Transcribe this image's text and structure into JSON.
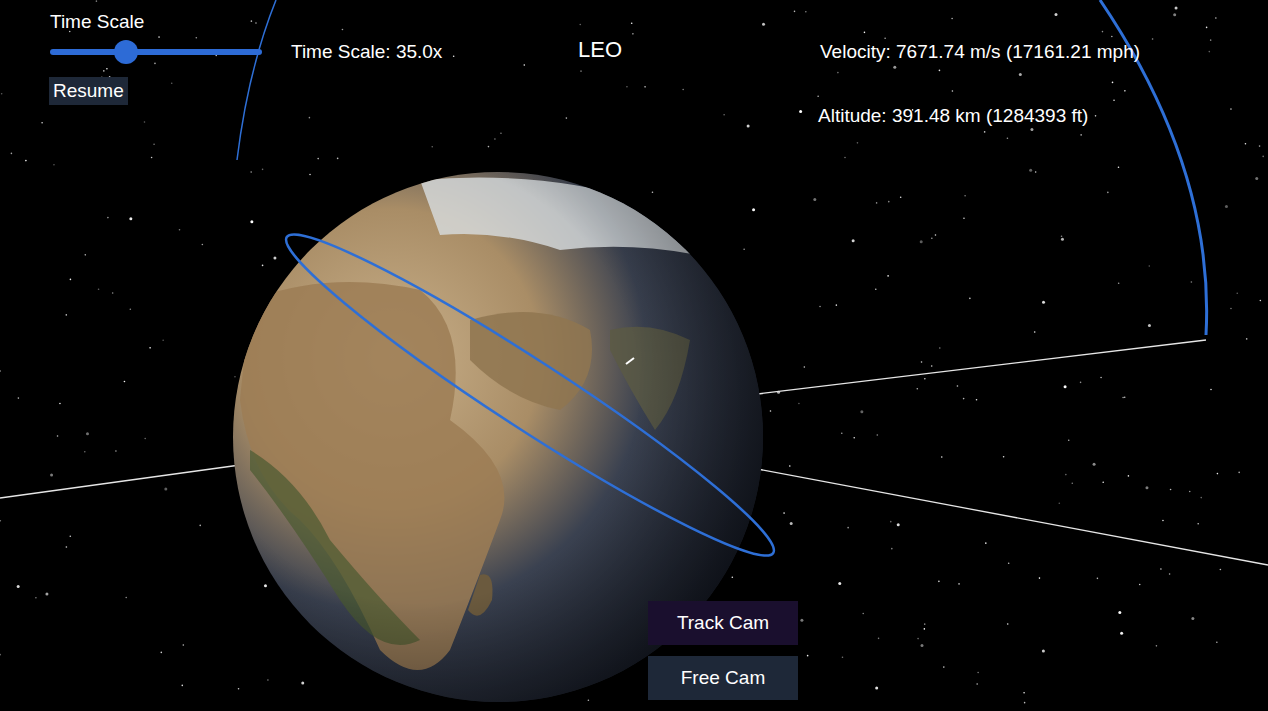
{
  "title": "LEO",
  "time_scale": {
    "label": "Time Scale",
    "level": 0.36,
    "reading": "Time Scale: 35.0x"
  },
  "playback_button": "Resume",
  "telemetry": {
    "velocity": "Velocity: 7671.74 m/s (17161.21 mph)",
    "altitude": "Altitude: 391.48 km (1284393 ft)"
  },
  "camera_buttons": [
    {
      "label": "Track Cam",
      "selected": true
    },
    {
      "label": "Free Cam",
      "selected": false
    }
  ]
}
